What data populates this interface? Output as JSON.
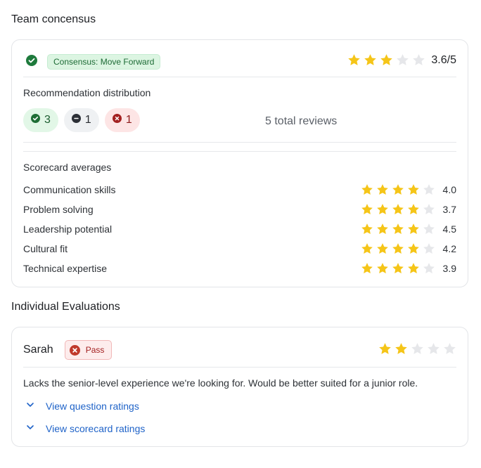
{
  "consensus": {
    "section_title": "Team concensus",
    "badge_label": "Consensus: Move Forward",
    "rating_value": 3.6,
    "rating_text": "3.6/5",
    "distribution_title": "Recommendation distribution",
    "counts": {
      "positive": "3",
      "neutral": "1",
      "negative": "1"
    },
    "total_reviews": "5 total reviews",
    "scorecard_title": "Scorecard averages",
    "scorecard": [
      {
        "label": "Communication skills",
        "value": "4.0",
        "stars": 4
      },
      {
        "label": "Problem solving",
        "value": "3.7",
        "stars": 4
      },
      {
        "label": "Leadership potential",
        "value": "4.5",
        "stars": 4
      },
      {
        "label": "Cultural fit",
        "value": "4.2",
        "stars": 4
      },
      {
        "label": "Technical expertise",
        "value": "3.9",
        "stars": 4
      }
    ]
  },
  "evaluations": {
    "section_title": "Individual Evaluations",
    "items": [
      {
        "name": "Sarah",
        "decision": "Pass",
        "stars": 2,
        "comment": "Lacks the senior-level experience we're looking for. Would be better suited for a junior role.",
        "link_questions": "View question ratings",
        "link_scorecard": "View scorecard ratings"
      }
    ]
  },
  "colors": {
    "star_filled": "#f5c518",
    "star_empty": "#e6e7ea",
    "accent_link": "#1f63c8",
    "positive": "#1e7a3c",
    "negative": "#b42323"
  }
}
